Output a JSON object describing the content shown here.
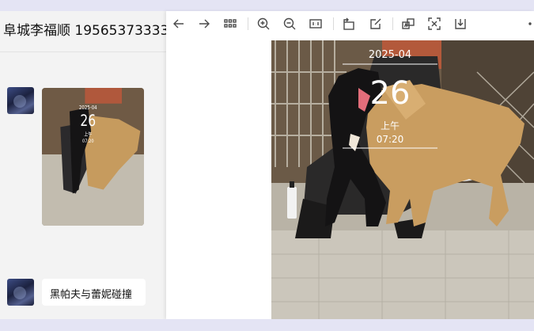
{
  "chat": {
    "title": "阜城李福顺 19565373333",
    "message_text": "黑帕夫与蕾妮碰撞"
  },
  "watermark": {
    "date": "2025-04",
    "day": "26",
    "period": "上午",
    "time": "07:20"
  },
  "viewer": {
    "toolbar": [
      {
        "name": "back-arrow-icon"
      },
      {
        "name": "forward-arrow-icon"
      },
      {
        "name": "grid-view-icon"
      },
      {
        "name": "zoom-in-icon"
      },
      {
        "name": "zoom-out-icon"
      },
      {
        "name": "actual-size-icon"
      },
      {
        "name": "rotate-icon"
      },
      {
        "name": "edit-icon"
      },
      {
        "name": "translate-icon"
      },
      {
        "name": "scan-icon"
      },
      {
        "name": "download-icon"
      },
      {
        "name": "more-icon"
      }
    ]
  },
  "colors": {
    "accent_bg": "#e4e4f4",
    "panel_bg": "#f3f3f3"
  }
}
